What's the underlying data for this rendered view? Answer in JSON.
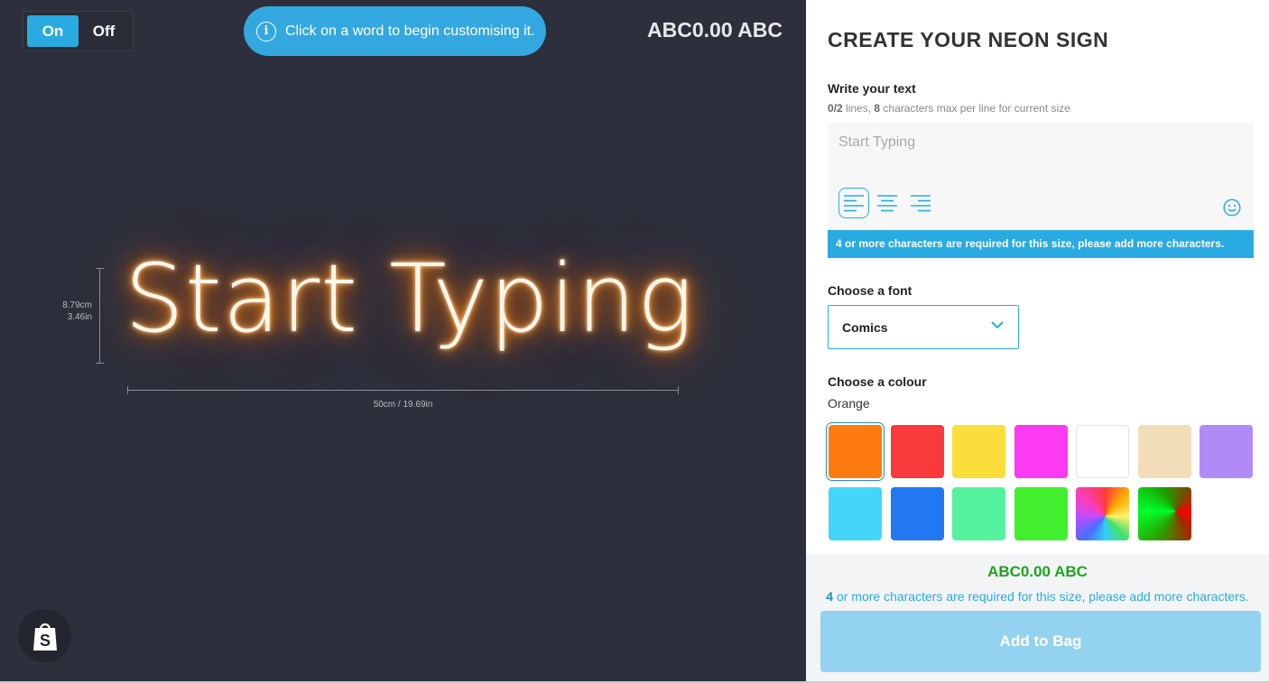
{
  "toggle": {
    "on_label": "On",
    "off_label": "Off"
  },
  "hint": {
    "icon": "info-icon",
    "text": "Click on a word to begin customising it."
  },
  "price_top": "ABC0.00 ABC",
  "preview": {
    "neon_text": "Start Typing",
    "neon_color": "#ff7a00",
    "height_cm": "8.79cm",
    "height_in": "3.46in",
    "width_label": "50cm / 19.69in"
  },
  "panel": {
    "title": "CREATE YOUR NEON SIGN",
    "text_section": {
      "label": "Write your text",
      "lines_current": "0",
      "lines_max": "/2",
      "lines_suffix": " lines, ",
      "chars_max": "8",
      "chars_suffix": " characters max per line for current size",
      "placeholder": "Start Typing",
      "alignment_selected": "left",
      "alignment_options": [
        "left",
        "center",
        "right"
      ],
      "emoji_icon": "smiley-icon"
    },
    "warning": {
      "count": "4",
      "text": " or more characters are required for this size, please add more characters."
    },
    "font_section": {
      "label": "Choose a font",
      "selected": "Comics"
    },
    "colour_section": {
      "label": "Choose a colour",
      "selected_name": "Orange",
      "swatches": [
        {
          "name": "orange",
          "color": "#ff7b12",
          "selected": true
        },
        {
          "name": "red",
          "color": "#f83a3a"
        },
        {
          "name": "yellow",
          "color": "#fbdd3c"
        },
        {
          "name": "pink",
          "color": "#fb3af2"
        },
        {
          "name": "white",
          "color": "#ffffff"
        },
        {
          "name": "warm-white",
          "color": "#f2ddb9"
        },
        {
          "name": "purple",
          "color": "#b18bf5"
        },
        {
          "name": "ice-blue",
          "color": "#43d5fa"
        },
        {
          "name": "blue",
          "color": "#2277f2"
        },
        {
          "name": "mint",
          "color": "#56f39f"
        },
        {
          "name": "green",
          "color": "#42ef2e"
        },
        {
          "name": "rainbow",
          "color": "multicolor"
        },
        {
          "name": "rgb-colour-changing",
          "color": "multicolor"
        }
      ]
    }
  },
  "footer": {
    "price": "ABC0.00 ABC",
    "note_count": "4",
    "note_text": " or more characters are required for this size, please add more characters.",
    "add_button": "Add to Bag"
  },
  "shop_icon": "shopify-bag-icon"
}
